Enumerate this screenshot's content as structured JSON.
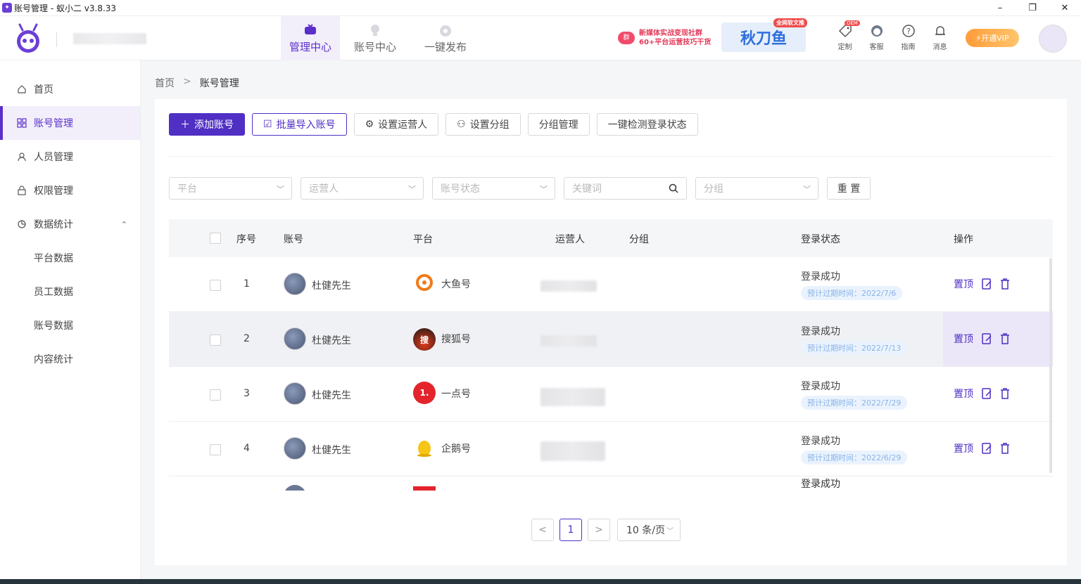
{
  "window": {
    "title": "账号管理 - 蚁小二 v3.8.33",
    "minimize": "–",
    "maximize": "❐",
    "close": "✕"
  },
  "topnav": {
    "tabs": [
      {
        "label": "管理中心",
        "active": true
      },
      {
        "label": "账号中心",
        "active": false
      },
      {
        "label": "一键发布",
        "active": false
      }
    ],
    "promo1": {
      "badge": "群",
      "line1": "新媒体实战变现社群",
      "line2": "60+平台运营技巧干货"
    },
    "promo2": {
      "label": "秋刀鱼",
      "tag": "全网软文推"
    },
    "tools": [
      {
        "label": "定制",
        "icon": "tag-icon",
        "badge": "OEM"
      },
      {
        "label": "客服",
        "icon": "headset-icon"
      },
      {
        "label": "指南",
        "icon": "help-circle-icon"
      },
      {
        "label": "消息",
        "icon": "bell-icon"
      }
    ],
    "vip": "开通VIP"
  },
  "sidebar": {
    "items": [
      {
        "label": "首页",
        "icon": "home-icon"
      },
      {
        "label": "账号管理",
        "icon": "grid-icon",
        "active": true
      },
      {
        "label": "人员管理",
        "icon": "user-icon"
      },
      {
        "label": "权限管理",
        "icon": "lock-icon"
      },
      {
        "label": "数据统计",
        "icon": "chart-icon",
        "expanded": true
      }
    ],
    "subitems": [
      "平台数据",
      "员工数据",
      "账号数据",
      "内容统计"
    ]
  },
  "breadcrumb": {
    "home": "首页",
    "sep": ">",
    "current": "账号管理"
  },
  "actions": {
    "add": "添加账号",
    "import": "批量导入账号",
    "set_operator": "设置运营人",
    "set_group": "设置分组",
    "group_manage": "分组管理",
    "check_login": "一键检测登录状态"
  },
  "filters": {
    "platform": "平台",
    "operator": "运营人",
    "status": "账号状态",
    "keyword": "关键词",
    "group": "分组",
    "reset": "重 置"
  },
  "table": {
    "headers": {
      "index": "序号",
      "account": "账号",
      "platform": "平台",
      "operator": "运营人",
      "group": "分组",
      "status": "登录状态",
      "ops": "操作"
    },
    "rows": [
      {
        "index": "1",
        "account": "杜健先生",
        "platform": "大鱼号",
        "status": "登录成功",
        "expire": "预计过期时间：2022/7/6",
        "pin": "置顶"
      },
      {
        "index": "2",
        "account": "杜健先生",
        "platform": "搜狐号",
        "status": "登录成功",
        "expire": "预计过期时间：2022/7/13",
        "pin": "置顶"
      },
      {
        "index": "3",
        "account": "杜健先生",
        "platform": "一点号",
        "status": "登录成功",
        "expire": "预计过期时间：2022/7/29",
        "pin": "置顶"
      },
      {
        "index": "4",
        "account": "杜健先生",
        "platform": "企鹅号",
        "status": "登录成功",
        "expire": "预计过期时间：2022/6/29",
        "pin": "置顶"
      }
    ],
    "partial_row": {
      "status": "登录成功"
    }
  },
  "pagination": {
    "prev": "<",
    "page": "1",
    "next": ">",
    "size": "10 条/页"
  },
  "colors": {
    "primary": "#4f2fc4",
    "active_bg": "#f2effb",
    "expire_text": "#8ab3e8"
  }
}
